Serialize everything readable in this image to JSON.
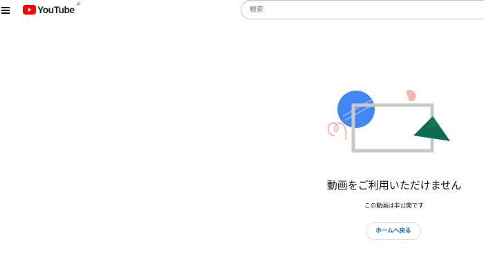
{
  "header": {
    "logo": {
      "wordmark": "YouTube",
      "region": "JP",
      "brand_color": "#ff0000"
    },
    "menu_icon": "hamburger-menu-icon",
    "search": {
      "placeholder": "検索",
      "value": ""
    }
  },
  "error": {
    "title": "動画をご利用いただけません",
    "message": "この動画は非公開です",
    "home_button_label": "ホームへ戻る",
    "colors": {
      "blue_circle": "#4285f4",
      "green_triangle": "#0f6b4f",
      "frame": "#c8c8c8",
      "pink_accent": "#f4b6b0",
      "link": "#065fd4"
    }
  }
}
